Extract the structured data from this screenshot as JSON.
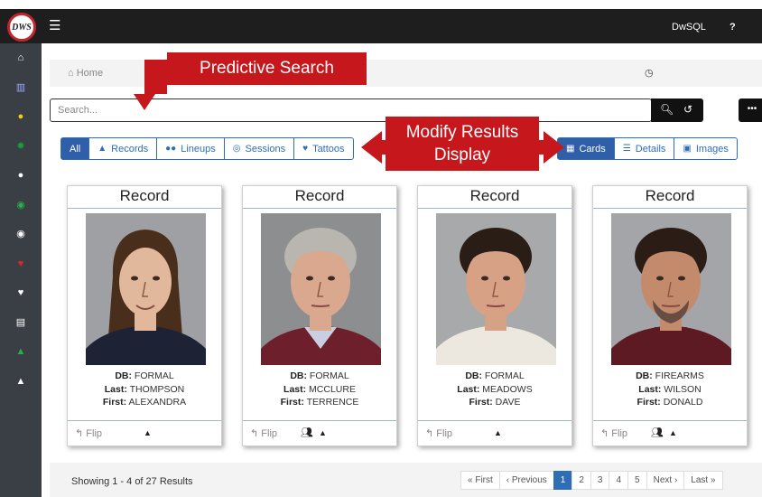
{
  "app": {
    "logo_text": "DWS",
    "title": "DwSQL",
    "help": "?"
  },
  "sidebar": {
    "icons": [
      {
        "name": "home-icon",
        "glyph": "⌂",
        "color": "#ffffff"
      },
      {
        "name": "chart-icon",
        "glyph": "▥",
        "color": "#9aa8ff"
      },
      {
        "name": "users-icon",
        "glyph": "●",
        "color": "#f2d000"
      },
      {
        "name": "gear-icon",
        "glyph": "✹",
        "color": "#1e9a3a"
      },
      {
        "name": "group-icon",
        "glyph": "●",
        "color": "#ffffff"
      },
      {
        "name": "user-circle-icon",
        "glyph": "◉",
        "color": "#27b04b"
      },
      {
        "name": "user-circle-icon",
        "glyph": "◉",
        "color": "#ffffff"
      },
      {
        "name": "heart-icon",
        "glyph": "♥",
        "color": "#e0252b"
      },
      {
        "name": "heart-icon",
        "glyph": "♥",
        "color": "#ffffff"
      },
      {
        "name": "database-icon",
        "glyph": "▤",
        "color": "#ffffff"
      },
      {
        "name": "user-icon",
        "glyph": "▲",
        "color": "#27b04b"
      },
      {
        "name": "user-icon",
        "glyph": "▲",
        "color": "#ffffff"
      }
    ]
  },
  "breadcrumb": {
    "home_icon": "⌂",
    "label": "Home"
  },
  "search": {
    "placeholder": "Search..."
  },
  "filters": [
    {
      "label": "All",
      "icon": ""
    },
    {
      "label": "Records",
      "icon": "▲"
    },
    {
      "label": "Lineups",
      "icon": "●●"
    },
    {
      "label": "Sessions",
      "icon": "◎"
    },
    {
      "label": "Tattoos",
      "icon": "♥"
    }
  ],
  "views": [
    {
      "label": "Cards",
      "icon": "▦"
    },
    {
      "label": "Details",
      "icon": "☰"
    },
    {
      "label": "Images",
      "icon": "▣"
    }
  ],
  "annotations": {
    "predictive": "Predictive Search",
    "modify_line1": "Modify Results",
    "modify_line2": "Display"
  },
  "cards": [
    {
      "title": "Record",
      "db_label": "DB:",
      "db": "FORMAL",
      "last_label": "Last:",
      "last": "THOMPSON",
      "first_label": "First:",
      "first": "ALEXANDRA",
      "flip": "Flip",
      "group": false,
      "bg": "#9ea0a3",
      "hair": "#4a2e1c",
      "skin": "#e2b89c",
      "shirt": "#1d2335",
      "collar": "#1d2335",
      "sex": "f"
    },
    {
      "title": "Record",
      "db_label": "DB:",
      "db": "FORMAL",
      "last_label": "Last:",
      "last": "MCCLURE",
      "first_label": "First:",
      "first": "TERRENCE",
      "flip": "Flip",
      "group": true,
      "bg": "#8c8e90",
      "hair": "#b9b6b0",
      "skin": "#d9a88f",
      "shirt": "#6e1f2c",
      "collar": "#c9cfe0",
      "sex": "m"
    },
    {
      "title": "Record",
      "db_label": "DB:",
      "db": "FORMAL",
      "last_label": "Last:",
      "last": "MEADOWS",
      "first_label": "First:",
      "first": "DAVE",
      "flip": "Flip",
      "group": false,
      "bg": "#a7a9ab",
      "hair": "#2a1d15",
      "skin": "#d7a186",
      "shirt": "#ece8df",
      "collar": "#ece8df",
      "sex": "m"
    },
    {
      "title": "Record",
      "db_label": "DB:",
      "db": "FIREARMS",
      "last_label": "Last:",
      "last": "WILSON",
      "first_label": "First:",
      "first": "DONALD",
      "flip": "Flip",
      "group": true,
      "bg": "#a3a5a8",
      "hair": "#2b1d16",
      "skin": "#c48a6c",
      "shirt": "#5e1a22",
      "collar": "#5e1a22",
      "sex": "m"
    }
  ],
  "footer": {
    "results": "Showing 1 - 4 of 27 Results",
    "pages": [
      "« First",
      "‹ Previous",
      "1",
      "2",
      "3",
      "4",
      "5",
      "Next ›",
      "Last »"
    ],
    "current_page": "1"
  }
}
